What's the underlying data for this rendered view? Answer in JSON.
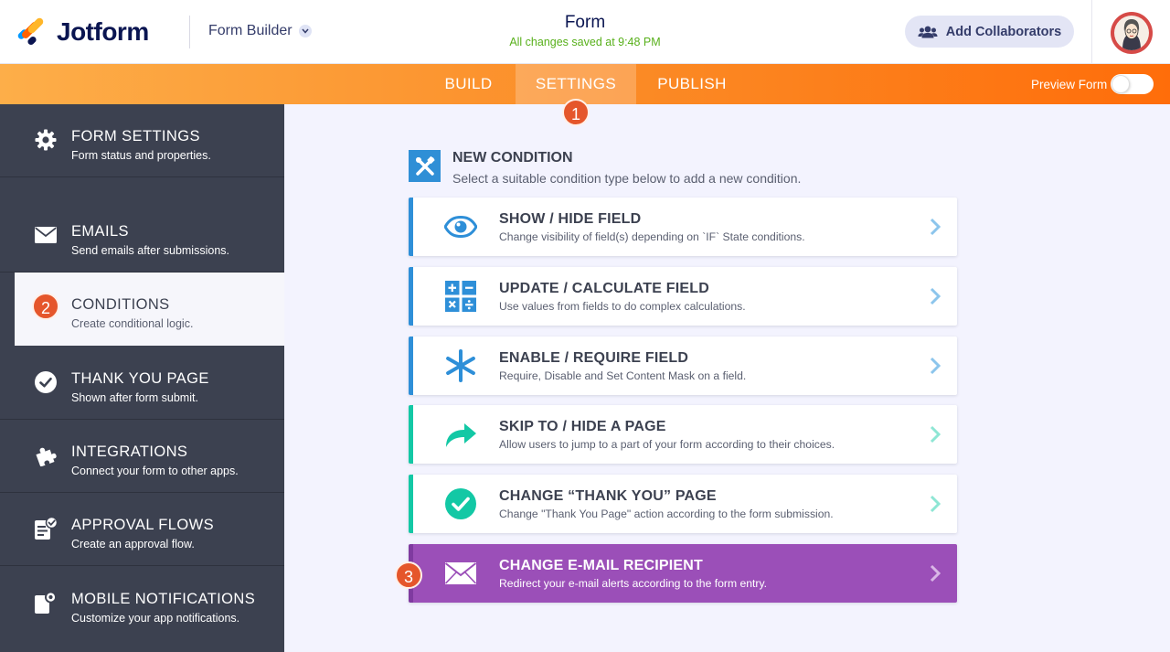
{
  "header": {
    "brand": "Jotform",
    "builder_label": "Form Builder",
    "form_title": "Form",
    "save_status": "All changes saved at 9:48 PM",
    "collab_label": "Add Collaborators"
  },
  "nav": {
    "tabs": [
      {
        "label": "BUILD"
      },
      {
        "label": "SETTINGS"
      },
      {
        "label": "PUBLISH"
      }
    ],
    "active_tab": "SETTINGS",
    "preview_label": "Preview Form"
  },
  "callouts": [
    "1",
    "2",
    "3"
  ],
  "sidebar": {
    "items": [
      {
        "title": "FORM SETTINGS",
        "subtitle": "Form status and properties.",
        "icon": "gear-icon"
      },
      {
        "title": "EMAILS",
        "subtitle": "Send emails after submissions.",
        "icon": "envelope-icon"
      },
      {
        "title": "CONDITIONS",
        "subtitle": "Create conditional logic.",
        "icon": "conditions-icon"
      },
      {
        "title": "THANK YOU PAGE",
        "subtitle": "Shown after form submit.",
        "icon": "check-circle-icon"
      },
      {
        "title": "INTEGRATIONS",
        "subtitle": "Connect your form to other apps.",
        "icon": "puzzle-icon"
      },
      {
        "title": "APPROVAL FLOWS",
        "subtitle": "Create an approval flow.",
        "icon": "approval-icon"
      },
      {
        "title": "MOBILE NOTIFICATIONS",
        "subtitle": "Customize your app notifications.",
        "icon": "mobile-notification-icon"
      }
    ],
    "active_item": "CONDITIONS"
  },
  "main": {
    "title": "NEW CONDITION",
    "subtitle": "Select a suitable condition type below to add a new condition.",
    "conditions": [
      {
        "title": "SHOW / HIDE FIELD",
        "desc": "Change visibility of field(s) depending on `IF` State conditions.",
        "icon": "eye-icon"
      },
      {
        "title": "UPDATE / CALCULATE FIELD",
        "desc": "Use values from fields to do complex calculations.",
        "icon": "calculator-icon"
      },
      {
        "title": "ENABLE / REQUIRE FIELD",
        "desc": "Require, Disable and Set Content Mask on a field.",
        "icon": "asterisk-icon"
      },
      {
        "title": "SKIP TO / HIDE A PAGE",
        "desc": "Allow users to jump to a part of your form according to their choices.",
        "icon": "skip-arrow-icon"
      },
      {
        "title": "CHANGE “THANK YOU” PAGE",
        "desc": "Change \"Thank You Page\" action according to the form submission.",
        "icon": "check-circle-icon"
      },
      {
        "title": "CHANGE E-MAIL RECIPIENT",
        "desc": "Redirect your e-mail alerts according to the form entry.",
        "icon": "envelope-icon"
      }
    ]
  },
  "colors": {
    "navy": "#0a1551",
    "orange_start": "#fdae49",
    "orange_end": "#ff6d0a",
    "sidebar_bg": "#3c4150",
    "blue_accent": "#2e8fd8",
    "teal_accent": "#13c8a5",
    "purple_highlight": "#9b4fb8",
    "badge": "#e5562b",
    "saved_green": "#58b01b"
  }
}
